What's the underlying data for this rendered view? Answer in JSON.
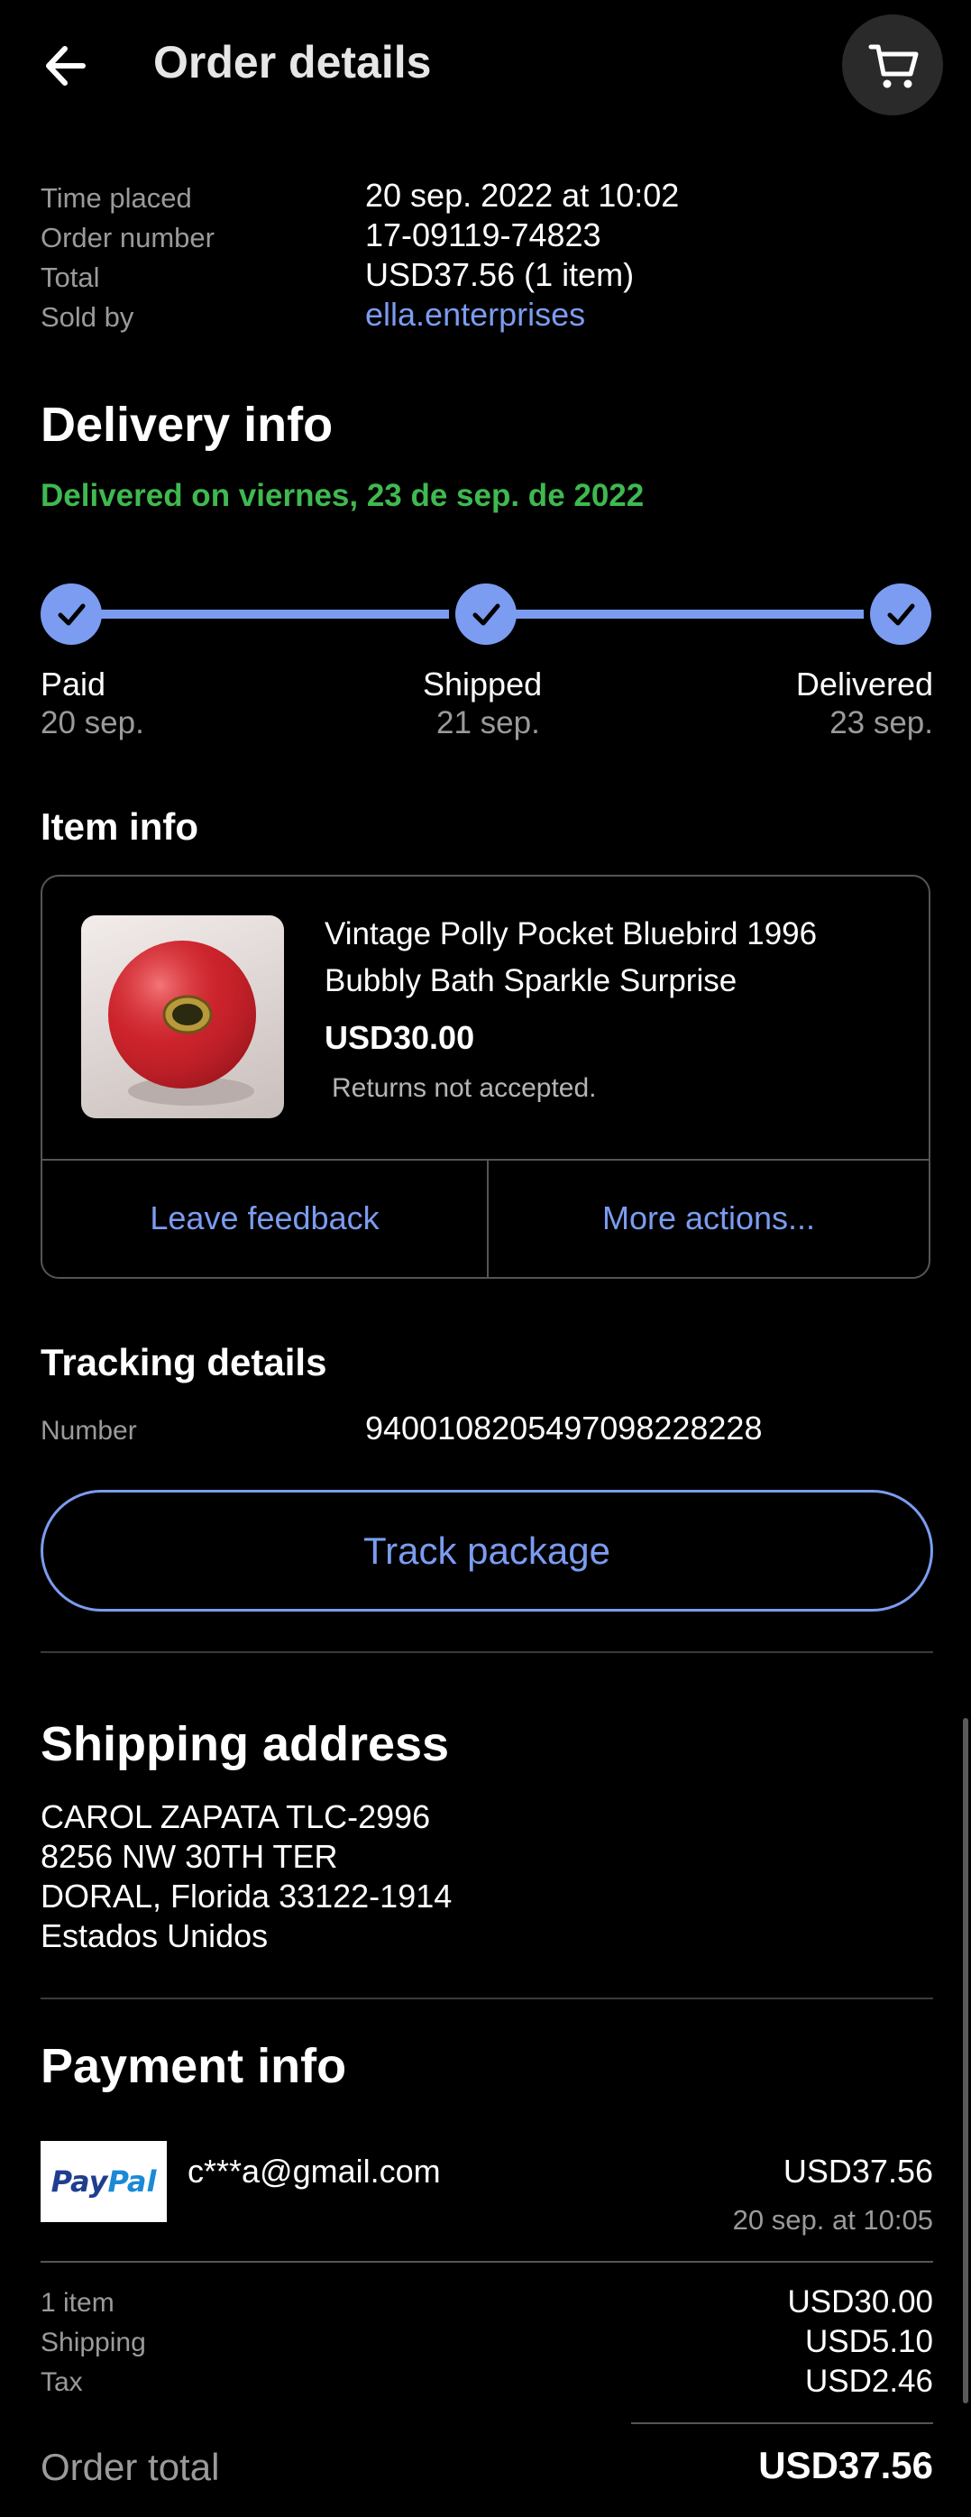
{
  "header": {
    "title": "Order details",
    "back_icon": "arrow-left-icon",
    "cart_icon": "shopping-cart-icon"
  },
  "summary": {
    "time_placed_label": "Time placed",
    "time_placed_value": "20 sep. 2022 at 10:02",
    "order_number_label": "Order number",
    "order_number_value": "17-09119-74823",
    "total_label": "Total",
    "total_value": "USD37.56 (1 item)",
    "sold_by_label": "Sold by",
    "sold_by_value": "ella.enterprises"
  },
  "delivery": {
    "heading": "Delivery info",
    "status": "Delivered on viernes, 23 de sep. de 2022",
    "steps": [
      {
        "label": "Paid",
        "date": "20 sep."
      },
      {
        "label": "Shipped",
        "date": "21 sep."
      },
      {
        "label": "Delivered",
        "date": "23 sep."
      }
    ],
    "progress_fraction": 1.0
  },
  "item": {
    "heading": "Item info",
    "title": "Vintage Polly Pocket Bluebird 1996 Bubbly Bath Sparkle Surprise",
    "price": "USD30.00",
    "returns": "Returns not accepted.",
    "leave_feedback": "Leave feedback",
    "more_actions": "More actions..."
  },
  "tracking": {
    "heading": "Tracking details",
    "number_label": "Number",
    "number_value": "9400108205497098228228",
    "track_button": "Track package"
  },
  "shipping": {
    "heading": "Shipping address",
    "lines": [
      "CAROL ZAPATA TLC-2996",
      "8256 NW 30TH TER",
      "DORAL, Florida 33122-1914",
      "Estados Unidos"
    ]
  },
  "payment": {
    "heading": "Payment info",
    "paypal_logo_a": "Pay",
    "paypal_logo_b": "Pal",
    "email": "c***a@gmail.com",
    "amount": "USD37.56",
    "date": "20 sep. at 10:05",
    "item_label": "1 item",
    "item_value": "USD30.00",
    "shipping_label": "Shipping",
    "shipping_value": "USD5.10",
    "tax_label": "Tax",
    "tax_value": "USD2.46",
    "order_total_label": "Order total",
    "order_total_value": "USD37.56"
  },
  "colors": {
    "accent": "#7b9cf0",
    "success": "#3fb950",
    "background": "#000000"
  }
}
